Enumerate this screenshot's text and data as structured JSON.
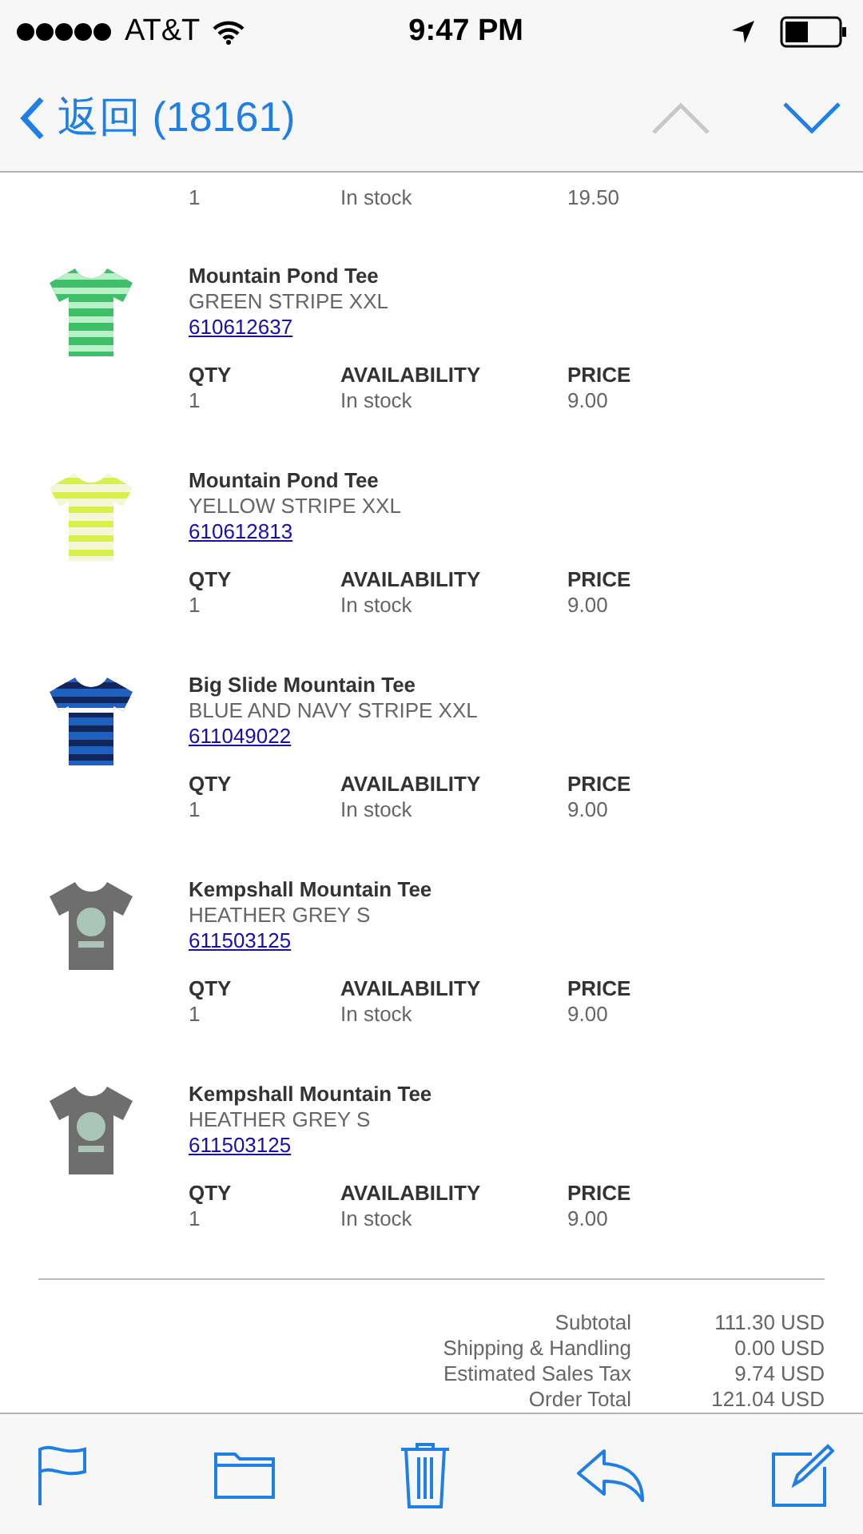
{
  "status_bar": {
    "carrier": "AT&T",
    "time": "9:47 PM"
  },
  "nav": {
    "back_label": "返回 (18161)",
    "previous": {
      "disabled": true
    },
    "next": {
      "disabled": false
    }
  },
  "partial_item": {
    "qty": "1",
    "availability": "In stock",
    "price": "19.50"
  },
  "items": [
    {
      "kind": "picture",
      "name": "Mountain Pond Tee",
      "variant": "GREEN STRIPE XXL",
      "sku": "610612637",
      "columns": [
        {
          "label": "QTY",
          "value": "1"
        },
        {
          "label": "AVAILABILITY",
          "value": "In stock"
        },
        {
          "label": "PRICE",
          "value": "9.00"
        }
      ]
    },
    {
      "kind": "picture",
      "name": "Mountain Pond Tee",
      "variant": "YELLOW STRIPE XXL",
      "sku": "610612813",
      "columns": [
        {
          "label": "QTY",
          "value": "1"
        },
        {
          "label": "AVAILABILITY",
          "value": "In stock"
        },
        {
          "label": "PRICE",
          "value": "9.00"
        }
      ]
    },
    {
      "kind": "picture",
      "name": "Big Slide Mountain Tee",
      "variant": "BLUE AND NAVY STRIPE XXL",
      "sku": "611049022",
      "columns": [
        {
          "label": "QTY",
          "value": "1"
        },
        {
          "label": "AVAILABILITY",
          "value": "In stock"
        },
        {
          "label": "PRICE",
          "value": "9.00"
        }
      ]
    },
    {
      "kind": "picture",
      "name": "Kempshall Mountain Tee",
      "variant": "HEATHER GREY S",
      "sku": "611503125",
      "columns": [
        {
          "label": "QTY",
          "value": "1"
        },
        {
          "label": "AVAILABILITY",
          "value": "In stock"
        },
        {
          "label": "PRICE",
          "value": "9.00"
        }
      ]
    },
    {
      "kind": "picture",
      "name": "Kempshall Mountain Tee",
      "variant": "HEATHER GREY S",
      "sku": "611503125",
      "columns": [
        {
          "label": "QTY",
          "value": "1"
        },
        {
          "label": "AVAILABILITY",
          "value": "In stock"
        },
        {
          "label": "PRICE",
          "value": "9.00"
        }
      ]
    }
  ],
  "totals": [
    {
      "label": "Subtotal",
      "value": "111.30 USD"
    },
    {
      "label": "Shipping & Handling",
      "value": "0.00 USD"
    },
    {
      "label": "Estimated Sales Tax",
      "value": "9.74 USD"
    },
    {
      "label": "Order Total",
      "value": "121.04 USD"
    }
  ]
}
